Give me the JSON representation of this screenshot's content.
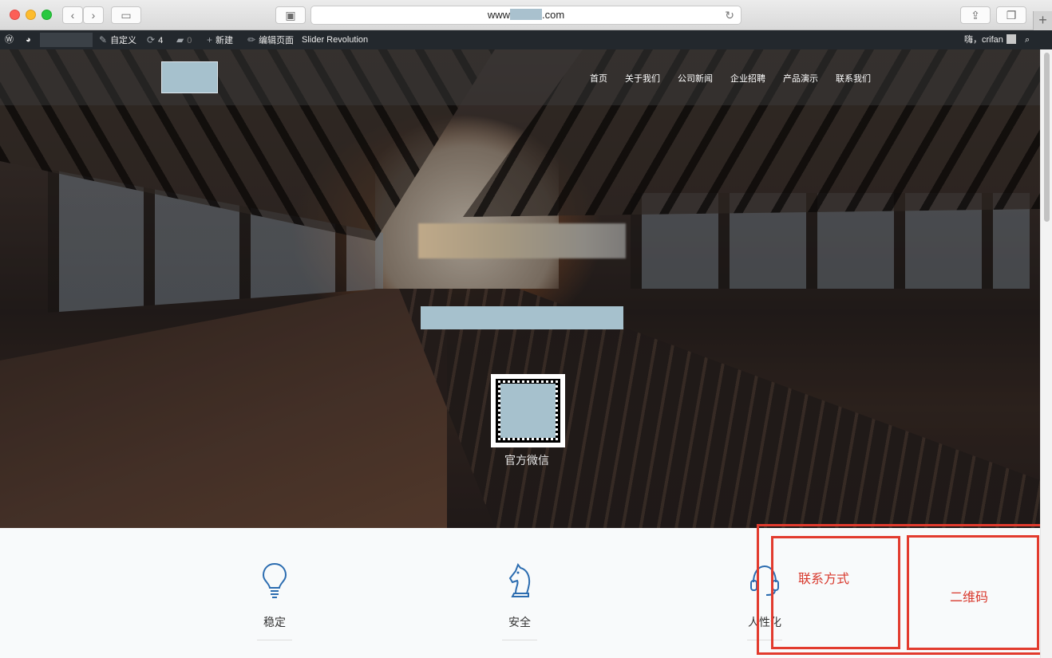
{
  "browser": {
    "url_prefix": "www",
    "url_suffix": ".com",
    "back": "‹",
    "forward": "›",
    "reload": "↻",
    "new_tab": "+"
  },
  "admin_bar": {
    "customize": "自定义",
    "updates_count": "4",
    "comments_count": "0",
    "new": "新建",
    "edit_page": "编辑页面",
    "slider": "Slider Revolution",
    "greeting": "嗨，crifan"
  },
  "nav": {
    "items": [
      "首页",
      "关于我们",
      "公司新闻",
      "企业招聘",
      "产品演示",
      "联系我们"
    ]
  },
  "hero": {
    "qr_caption": "官方微信"
  },
  "features": [
    {
      "label": "稳定",
      "icon": "lightbulb-icon"
    },
    {
      "label": "安全",
      "icon": "chess-knight-icon"
    },
    {
      "label": "人性化",
      "icon": "headset-icon"
    }
  ],
  "annotations": {
    "contact": "联系方式",
    "qrcode": "二维码",
    "color": "#e23b2e"
  }
}
